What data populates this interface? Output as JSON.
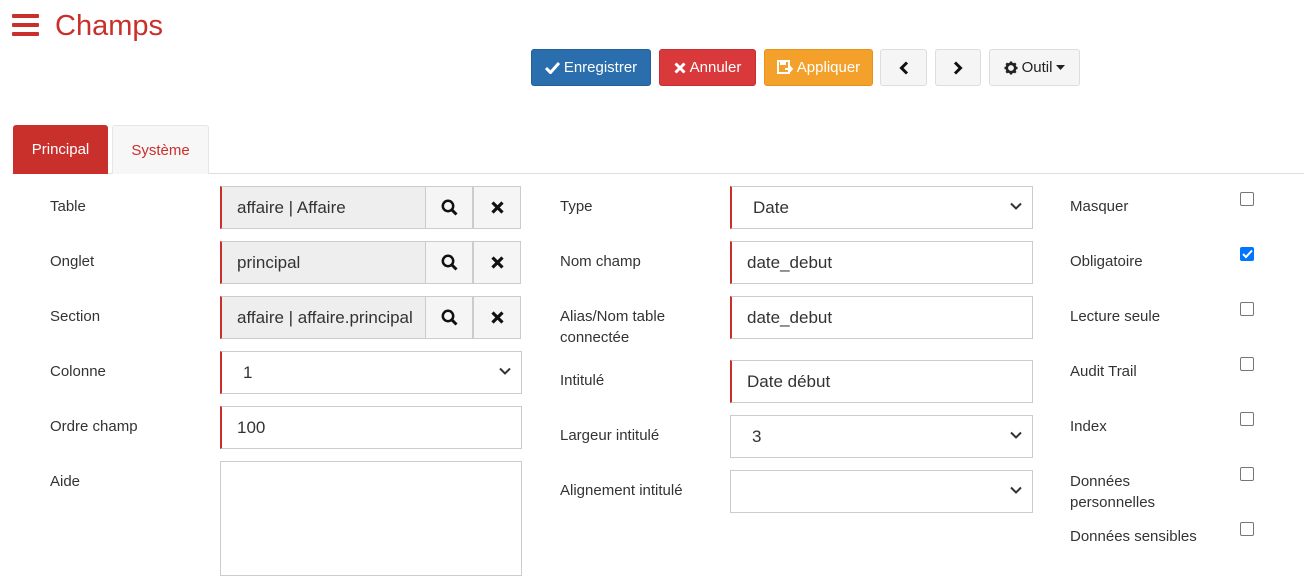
{
  "page": {
    "title": "Champs"
  },
  "toolbar": {
    "save_label": "Enregistrer",
    "cancel_label": "Annuler",
    "apply_label": "Appliquer",
    "tools_label": "Outil"
  },
  "tabs": [
    {
      "label": "Principal",
      "active": true
    },
    {
      "label": "Système",
      "active": false
    }
  ],
  "left": {
    "table": {
      "label": "Table",
      "value": "affaire | Affaire"
    },
    "onglet": {
      "label": "Onglet",
      "value": "principal"
    },
    "section": {
      "label": "Section",
      "value": "affaire | affaire.principal"
    },
    "colonne": {
      "label": "Colonne",
      "value": "1"
    },
    "ordre": {
      "label": "Ordre champ",
      "value": "100"
    },
    "aide": {
      "label": "Aide",
      "value": ""
    }
  },
  "middle": {
    "type": {
      "label": "Type",
      "value": "Date"
    },
    "nom": {
      "label": "Nom champ",
      "value": "date_debut"
    },
    "alias": {
      "label1": "Alias/Nom table",
      "label2": "connectée",
      "value": "date_debut"
    },
    "intitule": {
      "label": "Intitulé",
      "value": "Date début"
    },
    "largeur": {
      "label": "Largeur intitulé",
      "value": "3"
    },
    "alignement": {
      "label": "Alignement intitulé",
      "value": ""
    }
  },
  "right": {
    "masquer": {
      "label": "Masquer",
      "checked": false
    },
    "obligatoire": {
      "label": "Obligatoire",
      "checked": true
    },
    "lecture": {
      "label": "Lecture seule",
      "checked": false
    },
    "audit": {
      "label": "Audit Trail",
      "checked": false
    },
    "index": {
      "label": "Index",
      "checked": false
    },
    "perso": {
      "label1": "Données",
      "label2": "personnelles",
      "checked": false
    },
    "sensibles": {
      "label": "Données sensibles",
      "checked": false
    }
  },
  "colors": {
    "brand": "#c9302c",
    "primary": "#2a6ead",
    "danger": "#d9393b",
    "warning": "#f4a12c",
    "check": "#0075ff"
  },
  "icons": [
    "menu-icon",
    "check-icon",
    "times-icon",
    "apply-icon",
    "chevron-left-icon",
    "chevron-right-icon",
    "gear-icon",
    "caret-down-icon",
    "search-icon",
    "close-icon",
    "chevron-down-icon"
  ]
}
